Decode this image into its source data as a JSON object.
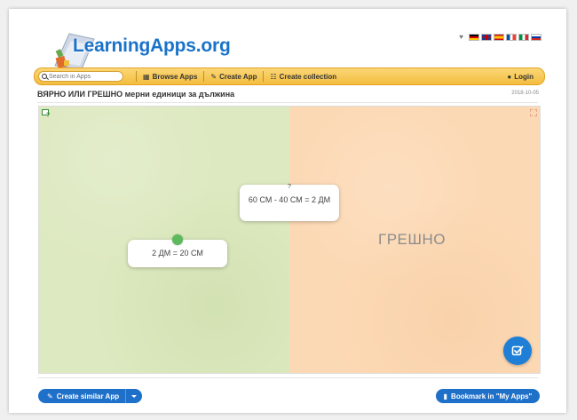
{
  "header": {
    "logo_text": "LearningApps.org",
    "heart": "♥",
    "languages": [
      "de",
      "gb",
      "es",
      "fr",
      "it",
      "ru"
    ]
  },
  "navbar": {
    "search_placeholder": "Search in Apps",
    "browse_label": "Browse Apps",
    "create_label": "Create App",
    "collection_label": "Create collection",
    "login_label": "Login"
  },
  "app": {
    "title": "ВЯРНО ИЛИ ГРЕШНО мерни единици за дължина",
    "date": "2018-10-05"
  },
  "game": {
    "left_zone_label": "",
    "right_zone_label": "ГРЕШНО",
    "cards": [
      {
        "marker": "?",
        "text": "60 СМ - 40 СМ = 2 ДМ"
      },
      {
        "marker": "",
        "text": "2 ДМ = 20 СМ"
      }
    ],
    "colors": {
      "left_zone": "#dde9c0",
      "right_zone": "#fcd9b5",
      "check_button": "#1f7fd6",
      "dot": "#5cba5c"
    }
  },
  "footer": {
    "create_similar_label": "Create similar App",
    "bookmark_label": "Bookmark in \"My Apps\""
  },
  "theme": {
    "accent": "#1f70c9",
    "navbar": "#f3bd3f"
  }
}
